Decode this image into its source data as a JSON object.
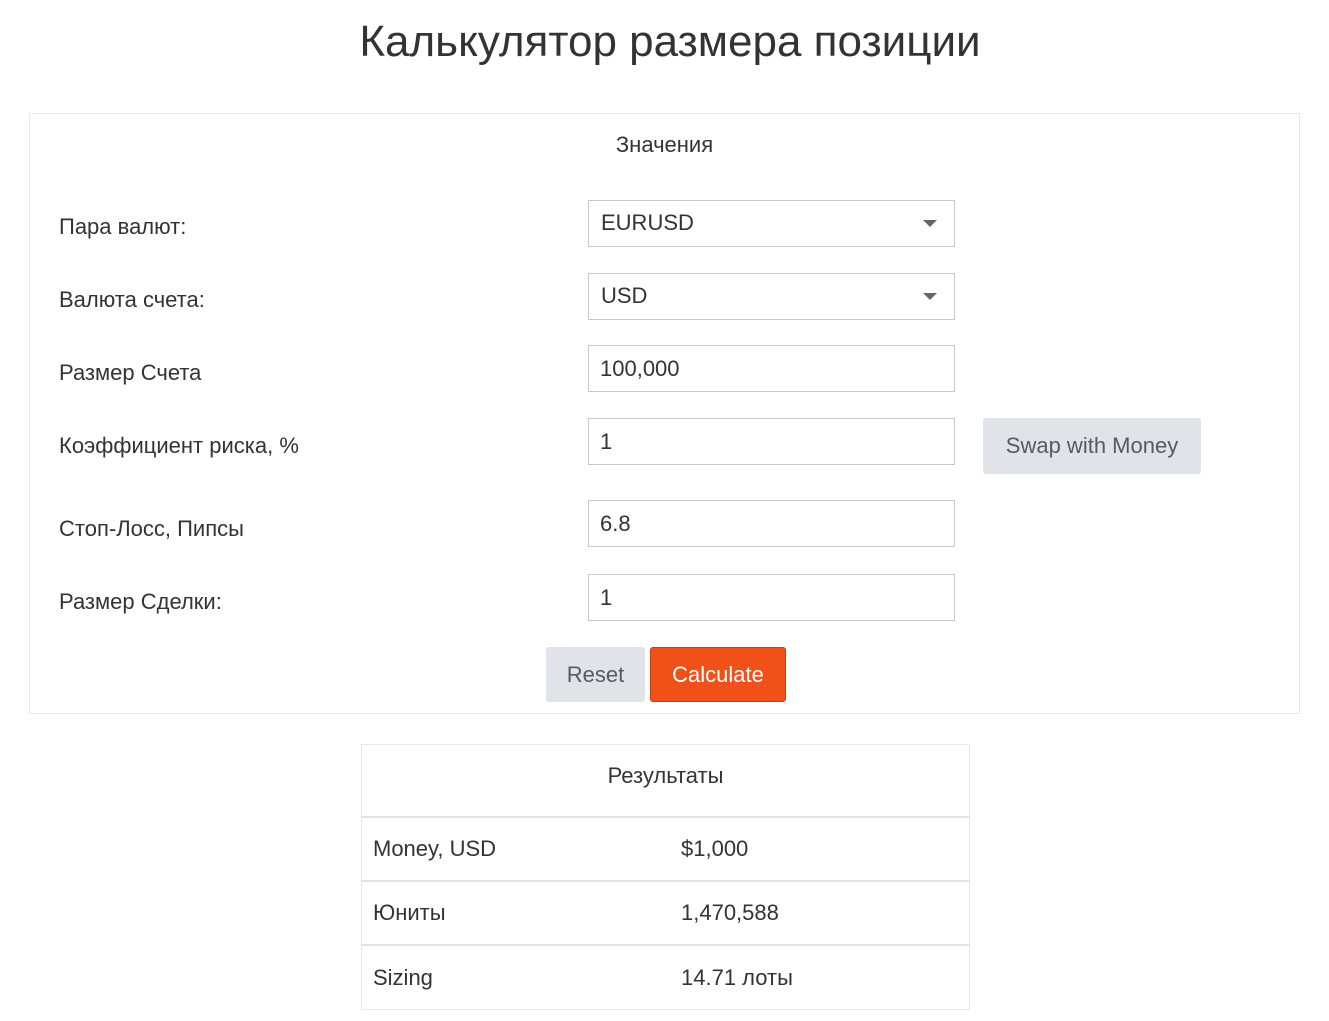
{
  "page": {
    "title": "Калькулятор размера позиции"
  },
  "values_panel": {
    "heading": "Значения",
    "currency_pair": {
      "label": "Пара валют:",
      "value": "EURUSD"
    },
    "account_currency": {
      "label": "Валюта счета:",
      "value": "USD"
    },
    "account_size": {
      "label": "Размер Счета",
      "value": "100,000"
    },
    "risk_ratio": {
      "label": "Коэффициент риска, %",
      "value": "1"
    },
    "stop_loss": {
      "label": "Стоп-Лосс, Пипсы",
      "value": "6.8"
    },
    "trade_size": {
      "label": "Размер Сделки:",
      "value": "1"
    },
    "swap_button_label": "Swap with Money",
    "reset_button_label": "Reset",
    "calculate_button_label": "Calculate"
  },
  "results_panel": {
    "heading": "Результаты",
    "rows": [
      {
        "label": "Money, USD",
        "value": "$1,000"
      },
      {
        "label": "Юниты",
        "value": "1,470,588"
      },
      {
        "label": "Sizing",
        "value": "14.71 лоты"
      }
    ]
  },
  "colors": {
    "accent": "#ef5118",
    "secondary_button": "#e0e3e8",
    "text": "#333333",
    "border": "#c8c8c8"
  }
}
